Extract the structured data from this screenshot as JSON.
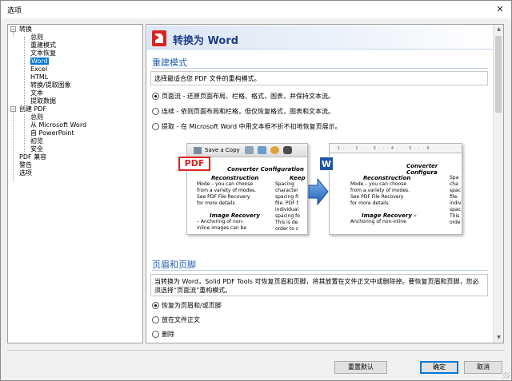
{
  "window": {
    "title": "选项"
  },
  "tree": {
    "items": [
      {
        "label": "转换",
        "level": 0,
        "expanded": true
      },
      {
        "label": "总则",
        "level": 1
      },
      {
        "label": "重建模式",
        "level": 1
      },
      {
        "label": "文本恢复",
        "level": 1
      },
      {
        "label": "Word",
        "level": 1,
        "selected": true
      },
      {
        "label": "Excel",
        "level": 1
      },
      {
        "label": "HTML",
        "level": 1
      },
      {
        "label": "转换/提取图象",
        "level": 1
      },
      {
        "label": "文本",
        "level": 1
      },
      {
        "label": "提取数据",
        "level": 1
      },
      {
        "label": "创建 PDF",
        "level": 0,
        "expanded": true
      },
      {
        "label": "总则",
        "level": 1
      },
      {
        "label": "从 Microsoft Word",
        "level": 1
      },
      {
        "label": "自 PowerPoint",
        "level": 1
      },
      {
        "label": "初览",
        "level": 1
      },
      {
        "label": "安全",
        "level": 1
      },
      {
        "label": "PDF 兼容",
        "level": 0
      },
      {
        "label": "警告",
        "level": 0
      },
      {
        "label": "选项",
        "level": 0
      }
    ]
  },
  "panel": {
    "header_title": "转换为 Word",
    "section1": {
      "title": "重建模式",
      "description": "选择最适合您 PDF 文件的重构模式。",
      "options": [
        {
          "label": "页面流 - 还原页面布局、栏格、格式，图表，并保持文本流。",
          "checked": true
        },
        {
          "label": "连续 - 依则页面布局和栏格，但仅恢复格式，图表和文本流。",
          "checked": false
        },
        {
          "label": "提取 - 在 Microsoft Word 中用文本框不折不扣地恢复页展示。",
          "checked": false
        }
      ]
    },
    "illustration": {
      "toolbar_label": "Save a Copy",
      "pdf_badge": "PDF",
      "word_badge": "W",
      "ruler_text": "1 · · · 2 · · · 3 · · · 4 · · · 5 · · · 6",
      "left_doc": {
        "title": "Converter Configuration",
        "sub1": "Reconstruction",
        "text1a": "Mode – you can choose",
        "text1b": "from a variety of modes.",
        "text1c": "See PDF File Recovery",
        "text1d": "for more details",
        "sub2": "Image Recovery",
        "text2a": "– Anchoring of non-",
        "text2b": "inline images can be",
        "col2_title": "Keep",
        "col2a": "Spacing",
        "col2b": "character",
        "col2c": "spacing fr",
        "col2d": "file. PDF t",
        "col2e": "individual",
        "col2f": "spacing fo",
        "col2g": "This is de",
        "col2h": "order to c"
      },
      "right_doc": {
        "title": "Converter Configura",
        "sub1": "Reconstruction",
        "text1a": "Mode – you can choose",
        "text1b": "from a variety of modes.",
        "text1c": "See PDF File Recovery",
        "text1d": "for more details",
        "sub2": "Image Recovery –",
        "text2a": "Anchoring of non-inline",
        "col2a": "Spa",
        "col2b": "cha",
        "col2c": "spac",
        "col2d": "file.",
        "col2e": "indiv",
        "col2f": "spac",
        "col2g": "This",
        "col2h": "orde"
      }
    },
    "section2": {
      "title": "页眉和页脚",
      "description": "当转换为 Word，Solid PDF Tools 可恢复页眉和页脚，将其放置在文件正文中或删除掉。要恢复页眉和页脚，您必须选择“页面流”重构模式。",
      "options": [
        {
          "label": "恢复为页眉和/或页脚",
          "checked": true
        },
        {
          "label": "放在文件正文",
          "checked": false
        },
        {
          "label": "删除",
          "checked": false
        }
      ]
    }
  },
  "buttons": {
    "reset": "重置默认",
    "ok": "确定",
    "cancel": "取消"
  },
  "colors": {
    "accent": "#0078d7",
    "section_title": "#1f5fb5",
    "header_title": "#1f3c88",
    "pdf_red": "#d9231f",
    "word_blue": "#1e56a8"
  }
}
